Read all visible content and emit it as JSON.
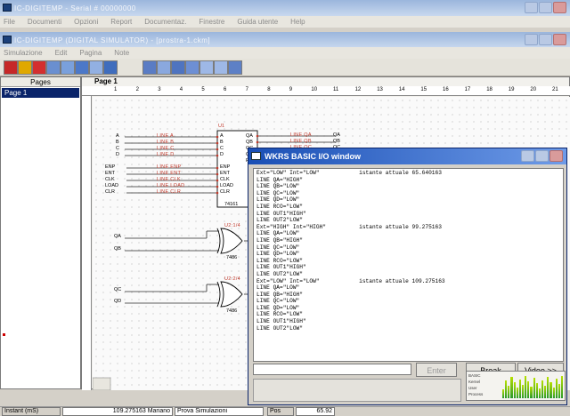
{
  "main_window": {
    "title": "IC-DIGITEMP - Serial # 00000000"
  },
  "main_menu": [
    "File",
    "Documenti",
    "Opzioni",
    "Report",
    "Documentaz.",
    "Finestre",
    "Guida utente",
    "Help"
  ],
  "sim_window": {
    "title": "IC-DIGITEMP (DIGITAL SIMULATOR) - [prostra-1.ckm]"
  },
  "sim_menu": [
    "Simulazione",
    "Edit",
    "Pagina",
    "Note"
  ],
  "pages_panel": {
    "header": "Pages",
    "items": [
      "Page 1"
    ]
  },
  "page_label": "Page 1",
  "ruler_numbers": [
    "1",
    "2",
    "3",
    "4",
    "5",
    "6",
    "7",
    "8",
    "9",
    "10",
    "11",
    "12",
    "13",
    "14",
    "15",
    "16",
    "17",
    "18",
    "19",
    "20",
    "21"
  ],
  "schematic": {
    "u1_label": "U1",
    "u1_part": "74161",
    "u1_left_pins": [
      "A",
      "B",
      "C",
      "D",
      "ENP",
      "ENT",
      "CLK",
      "LOAD",
      "CLR"
    ],
    "u1_right_pins": [
      "QA",
      "QB",
      "QC",
      "QD",
      "RC"
    ],
    "left_lines": [
      "LINE A",
      "LINE B",
      "LINE C",
      "LINE D",
      "LINE ENP",
      "LINE ENT",
      "LINE CLK",
      "LINE LOAD",
      "LINE CLR"
    ],
    "left_ports": [
      "A",
      "B",
      "C",
      "D",
      "ENP",
      "ENT",
      "CLK",
      "LOAD",
      "CLR"
    ],
    "right_lines": [
      "LINE QA",
      "LINE QB",
      "LINE QC"
    ],
    "right_ports": [
      "QA",
      "QB",
      "QC"
    ],
    "gate1_label": "U2:1/4",
    "gate1_part": "7486",
    "gate1_inputs": [
      "QA",
      "QB"
    ],
    "gate2_label": "U2:2/4",
    "gate2_part": "7486",
    "gate2_inputs": [
      "QC",
      "QD"
    ]
  },
  "io_window": {
    "title": "WKRS BASIC I/O window",
    "lines": [
      "Ext=\"LOW\" Int=\"LOW\"            istante attuale 65.640163",
      "LINE QA=\"HIGH\"",
      "LINE QB=\"LOW\"",
      "LINE QC=\"LOW\"",
      "LINE QD=\"LOW\"",
      "LINE RCO=\"LOW\"",
      "LINE OUT1\"HIGH\"",
      "LINE OUT2\"LOW\"",
      "Ext=\"HIGH\" Int=\"HIGH\"          istante attuale 99.275163",
      "LINE QA=\"LOW\"",
      "LINE QB=\"HIGH\"",
      "LINE QC=\"LOW\"",
      "LINE QD=\"LOW\"",
      "LINE RCO=\"LOW\"",
      "LINE OUT1\"HIGH\"",
      "LINE OUT2\"LOW\"",
      "Ext=\"LOW\" Int=\"LOW\"            istante attuale 109.275163",
      "LINE QA=\"LOW\"",
      "LINE QB=\"HIGH\"",
      "LINE QC=\"LOW\"",
      "LINE QD=\"LOW\"",
      "LINE RCO=\"LOW\"",
      "LINE OUT1\"HIGH\"",
      "LINE OUT2\"LOW\""
    ],
    "enter_label": "Enter",
    "break_label": "Break",
    "video_label": "Video >>",
    "meter_labels": [
      "BASIC",
      "Kernel",
      "User",
      "Process"
    ]
  },
  "status_bar": {
    "instant_label": "Instant (mS)",
    "instant_value": "109.275163 Mariano",
    "message": "Prova Simulazioni",
    "pos_label": "Pos",
    "pos_value": "65.92"
  }
}
